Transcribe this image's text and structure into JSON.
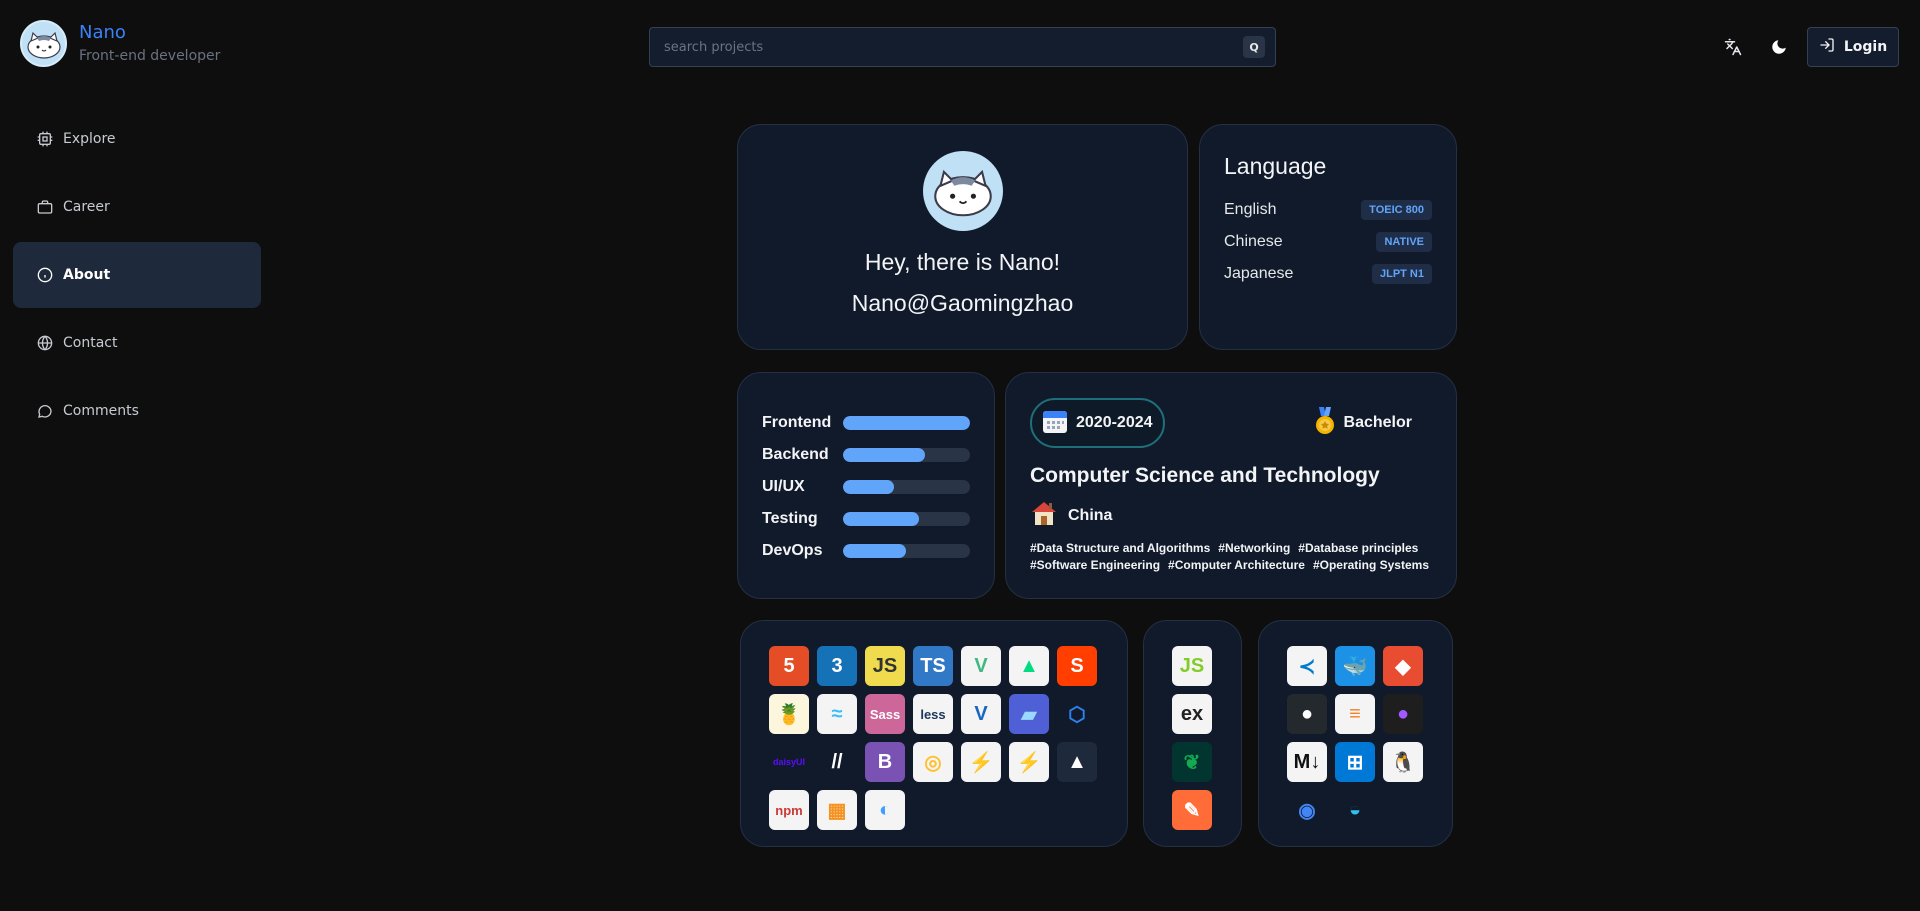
{
  "brand": {
    "name": "Nano",
    "role": "Front-end developer"
  },
  "search": {
    "placeholder": "search projects",
    "key": "Q"
  },
  "header": {
    "login_label": "Login"
  },
  "sidebar": {
    "items": [
      {
        "label": "Explore",
        "icon": "chip-icon"
      },
      {
        "label": "Career",
        "icon": "briefcase-icon"
      },
      {
        "label": "About",
        "icon": "info-icon",
        "active": true
      },
      {
        "label": "Contact",
        "icon": "globe-icon"
      },
      {
        "label": "Comments",
        "icon": "chat-icon"
      }
    ]
  },
  "profile": {
    "greeting": "Hey, there is Nano!",
    "handle": "Nano@Gaomingzhao"
  },
  "language": {
    "title": "Language",
    "items": [
      {
        "name": "English",
        "level": "TOEIC 800"
      },
      {
        "name": "Chinese",
        "level": "NATIVE"
      },
      {
        "name": "Japanese",
        "level": "JLPT N1"
      }
    ]
  },
  "skills": [
    {
      "name": "Frontend",
      "level": 1.0
    },
    {
      "name": "Backend",
      "level": 0.65
    },
    {
      "name": "UI/UX",
      "level": 0.4
    },
    {
      "name": "Testing",
      "level": 0.6
    },
    {
      "name": "DevOps",
      "level": 0.5
    }
  ],
  "education": {
    "years": "2020-2024",
    "degree": "Bachelor",
    "major": "Computer Science and Technology",
    "country": "China",
    "tags": [
      "#Data Structure and Algorithms",
      "#Networking",
      "#Database principles",
      "#Software Engineering",
      "#Computer Architecture",
      "#Operating Systems"
    ]
  },
  "tech": {
    "frontend": [
      {
        "name": "html5-icon",
        "label": "5",
        "bg": "#e44d26",
        "fg": "#ffffff"
      },
      {
        "name": "css3-icon",
        "label": "3",
        "bg": "#1572b6",
        "fg": "#ffffff"
      },
      {
        "name": "javascript-icon",
        "label": "JS",
        "bg": "#f0db4f",
        "fg": "#323330"
      },
      {
        "name": "typescript-icon",
        "label": "TS",
        "bg": "#3178c6",
        "fg": "#ffffff"
      },
      {
        "name": "vue-icon",
        "label": "V",
        "bg": "#f4f4f4",
        "fg": "#41b883"
      },
      {
        "name": "nuxt-icon",
        "label": "▲",
        "bg": "#f4f4f4",
        "fg": "#00dc82"
      },
      {
        "name": "svelte-icon",
        "label": "S",
        "bg": "#ff3e00",
        "fg": "#ffffff"
      },
      {
        "name": "pinia-icon",
        "label": "🍍",
        "bg": "#fbf6dc",
        "fg": "#000000"
      },
      {
        "name": "tailwind-icon",
        "label": "≈",
        "bg": "#f4f4f4",
        "fg": "#38bdf8"
      },
      {
        "name": "sass-icon",
        "label": "Sass",
        "bg": "#cd6799",
        "fg": "#ffffff"
      },
      {
        "name": "less-icon",
        "label": "less",
        "bg": "#f4f4f4",
        "fg": "#1d365d"
      },
      {
        "name": "vuetify-icon",
        "label": "V",
        "bg": "#f4f4f4",
        "fg": "#1867c0"
      },
      {
        "name": "windicss-icon",
        "label": "▰",
        "bg": "#4f5fd6",
        "fg": "#9ad8ff"
      },
      {
        "name": "electron-icon",
        "label": "⬡",
        "bg": "#111a2b",
        "fg": "#2f80ed"
      },
      {
        "name": "daisyui-icon",
        "label": "daisyUI",
        "bg": "#111a2b",
        "fg": "#5a0ef8"
      },
      {
        "name": "shadcn-icon",
        "label": "//",
        "bg": "#111a2b",
        "fg": "#ffffff"
      },
      {
        "name": "bootstrap-icon",
        "label": "B",
        "bg": "#7952b3",
        "fg": "#ffffff"
      },
      {
        "name": "tauri-icon",
        "label": "◎",
        "bg": "#f4f4f4",
        "fg": "#ffc131"
      },
      {
        "name": "vite-icon",
        "label": "⚡",
        "bg": "#f4f4f4",
        "fg": "#bd34fe"
      },
      {
        "name": "vitest-icon",
        "label": "⚡",
        "bg": "#f4f4f4",
        "fg": "#729b1b"
      },
      {
        "name": "vercel-icon",
        "label": "▲",
        "bg": "#1e293b",
        "fg": "#ffffff"
      },
      {
        "name": "npm-icon",
        "label": "npm",
        "bg": "#f4f4f4",
        "fg": "#cb3837"
      },
      {
        "name": "pnpm-icon",
        "label": "▦",
        "bg": "#f4f4f4",
        "fg": "#f69220"
      },
      {
        "name": "element-plus-icon",
        "label": "◐",
        "bg": "#f4f4f4",
        "fg": "#409eff"
      }
    ],
    "backend": [
      {
        "name": "nodejs-icon",
        "label": "JS",
        "bg": "#f4f4f4",
        "fg": "#83cd29"
      },
      {
        "name": "express-icon",
        "label": "ex",
        "bg": "#f4f4f4",
        "fg": "#222222"
      },
      {
        "name": "mongodb-icon",
        "label": "❦",
        "bg": "#023430",
        "fg": "#13aa52"
      },
      {
        "name": "postman-icon",
        "label": "✎",
        "bg": "#ff6c37",
        "fg": "#ffffff"
      }
    ],
    "tools": [
      {
        "name": "vscode-icon",
        "label": "≺",
        "bg": "#f4f4f4",
        "fg": "#007acc"
      },
      {
        "name": "docker-icon",
        "label": "🐳",
        "bg": "#1d91e6",
        "fg": "#ffffff"
      },
      {
        "name": "git-icon",
        "label": "◆",
        "bg": "#e84d31",
        "fg": "#ffffff"
      },
      {
        "name": "github-icon",
        "label": "●",
        "bg": "#24292e",
        "fg": "#ffffff"
      },
      {
        "name": "stackoverflow-icon",
        "label": "≡",
        "bg": "#f4f4f4",
        "fg": "#f48024"
      },
      {
        "name": "figma-icon",
        "label": "●",
        "bg": "#1e1e1e",
        "fg": "#a259ff"
      },
      {
        "name": "markdown-icon",
        "label": "M↓",
        "bg": "#f4f4f4",
        "fg": "#111111"
      },
      {
        "name": "windows-icon",
        "label": "⊞",
        "bg": "#0078d6",
        "fg": "#ffffff"
      },
      {
        "name": "linux-icon",
        "label": "🐧",
        "bg": "#f4f4f4",
        "fg": "#111111"
      },
      {
        "name": "chrome-icon",
        "label": "◉",
        "bg": "#111a2b",
        "fg": "#4285f4"
      },
      {
        "name": "edge-icon",
        "label": "◒",
        "bg": "#111a2b",
        "fg": "#2fc2f0"
      }
    ]
  },
  "colors": {
    "background": "#0e0e0f",
    "card": "#111a2b",
    "accent": "#3b82f6",
    "bar": "#60a5fa"
  }
}
